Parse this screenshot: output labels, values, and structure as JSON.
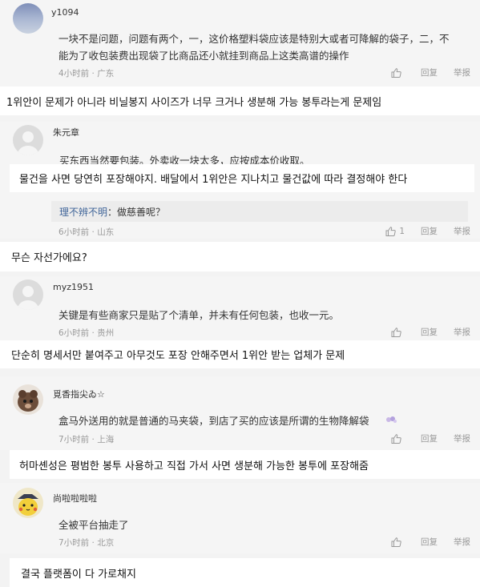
{
  "comments": [
    {
      "user": "y1094",
      "lines": [
        "一块不是问题，问题有两个，一，这价格塑料袋应该是特别大或者可降解的袋子，二，不",
        "能为了收包装费出现袋了比商品还小就挂到商品上这类高谱的操作"
      ],
      "meta": "4小时前 · 广东",
      "actions": [
        "",
        "回复",
        "举报"
      ],
      "translation": "1위안이 문제가 아니라 비닐봉지 사이즈가 너무 크거나 생분해 가능 봉투라는게 문제임"
    },
    {
      "user": "朱元章",
      "lines": [
        "买东西当然要包装。外卖收一块太多，应按成本价收取。"
      ],
      "translation_inline": "물건을 사면 당연히 포장해야지. 배달에서 1위안은 지나치고 물건값에 따라 결정해야 한다",
      "reply": {
        "name": "理不辨不明",
        "text": "：做慈善呢？"
      },
      "meta": "6小时前 · 山东",
      "actions": [
        "1",
        "回复",
        "举报"
      ],
      "translation": "무슨 자선가에요?"
    },
    {
      "user": "myz1951",
      "lines": [
        "关键是有些商家只是贴了个清单，并未有任何包装，也收一元。"
      ],
      "meta": "6小时前 · 贵州",
      "actions": [
        "",
        "回复",
        "举报"
      ],
      "translation": "단순히 명세서만 붙여주고 아무것도 포장 안해주면서 1위안 받는 업체가 문제"
    },
    {
      "user": "覓香指尖ゐ☆",
      "lines": [
        "盒马外送用的就是普通的马夹袋，到店了买的应该是所谓的生物降解袋"
      ],
      "meta": "7小时前 · 上海",
      "actions": [
        "",
        "回复",
        "举报"
      ],
      "translation": "허마셴성은 평범한 봉투 사용하고 직접 가서 사면 생분해 가능한 봉투에 포장해줌"
    },
    {
      "user": "尚啦啦啦啦",
      "lines": [
        "全被平台抽走了"
      ],
      "meta": "7小时前 · 北京",
      "actions": [
        "",
        "回复",
        "举报"
      ],
      "translation": "결국 플랫폼이 다 가로채지"
    }
  ]
}
